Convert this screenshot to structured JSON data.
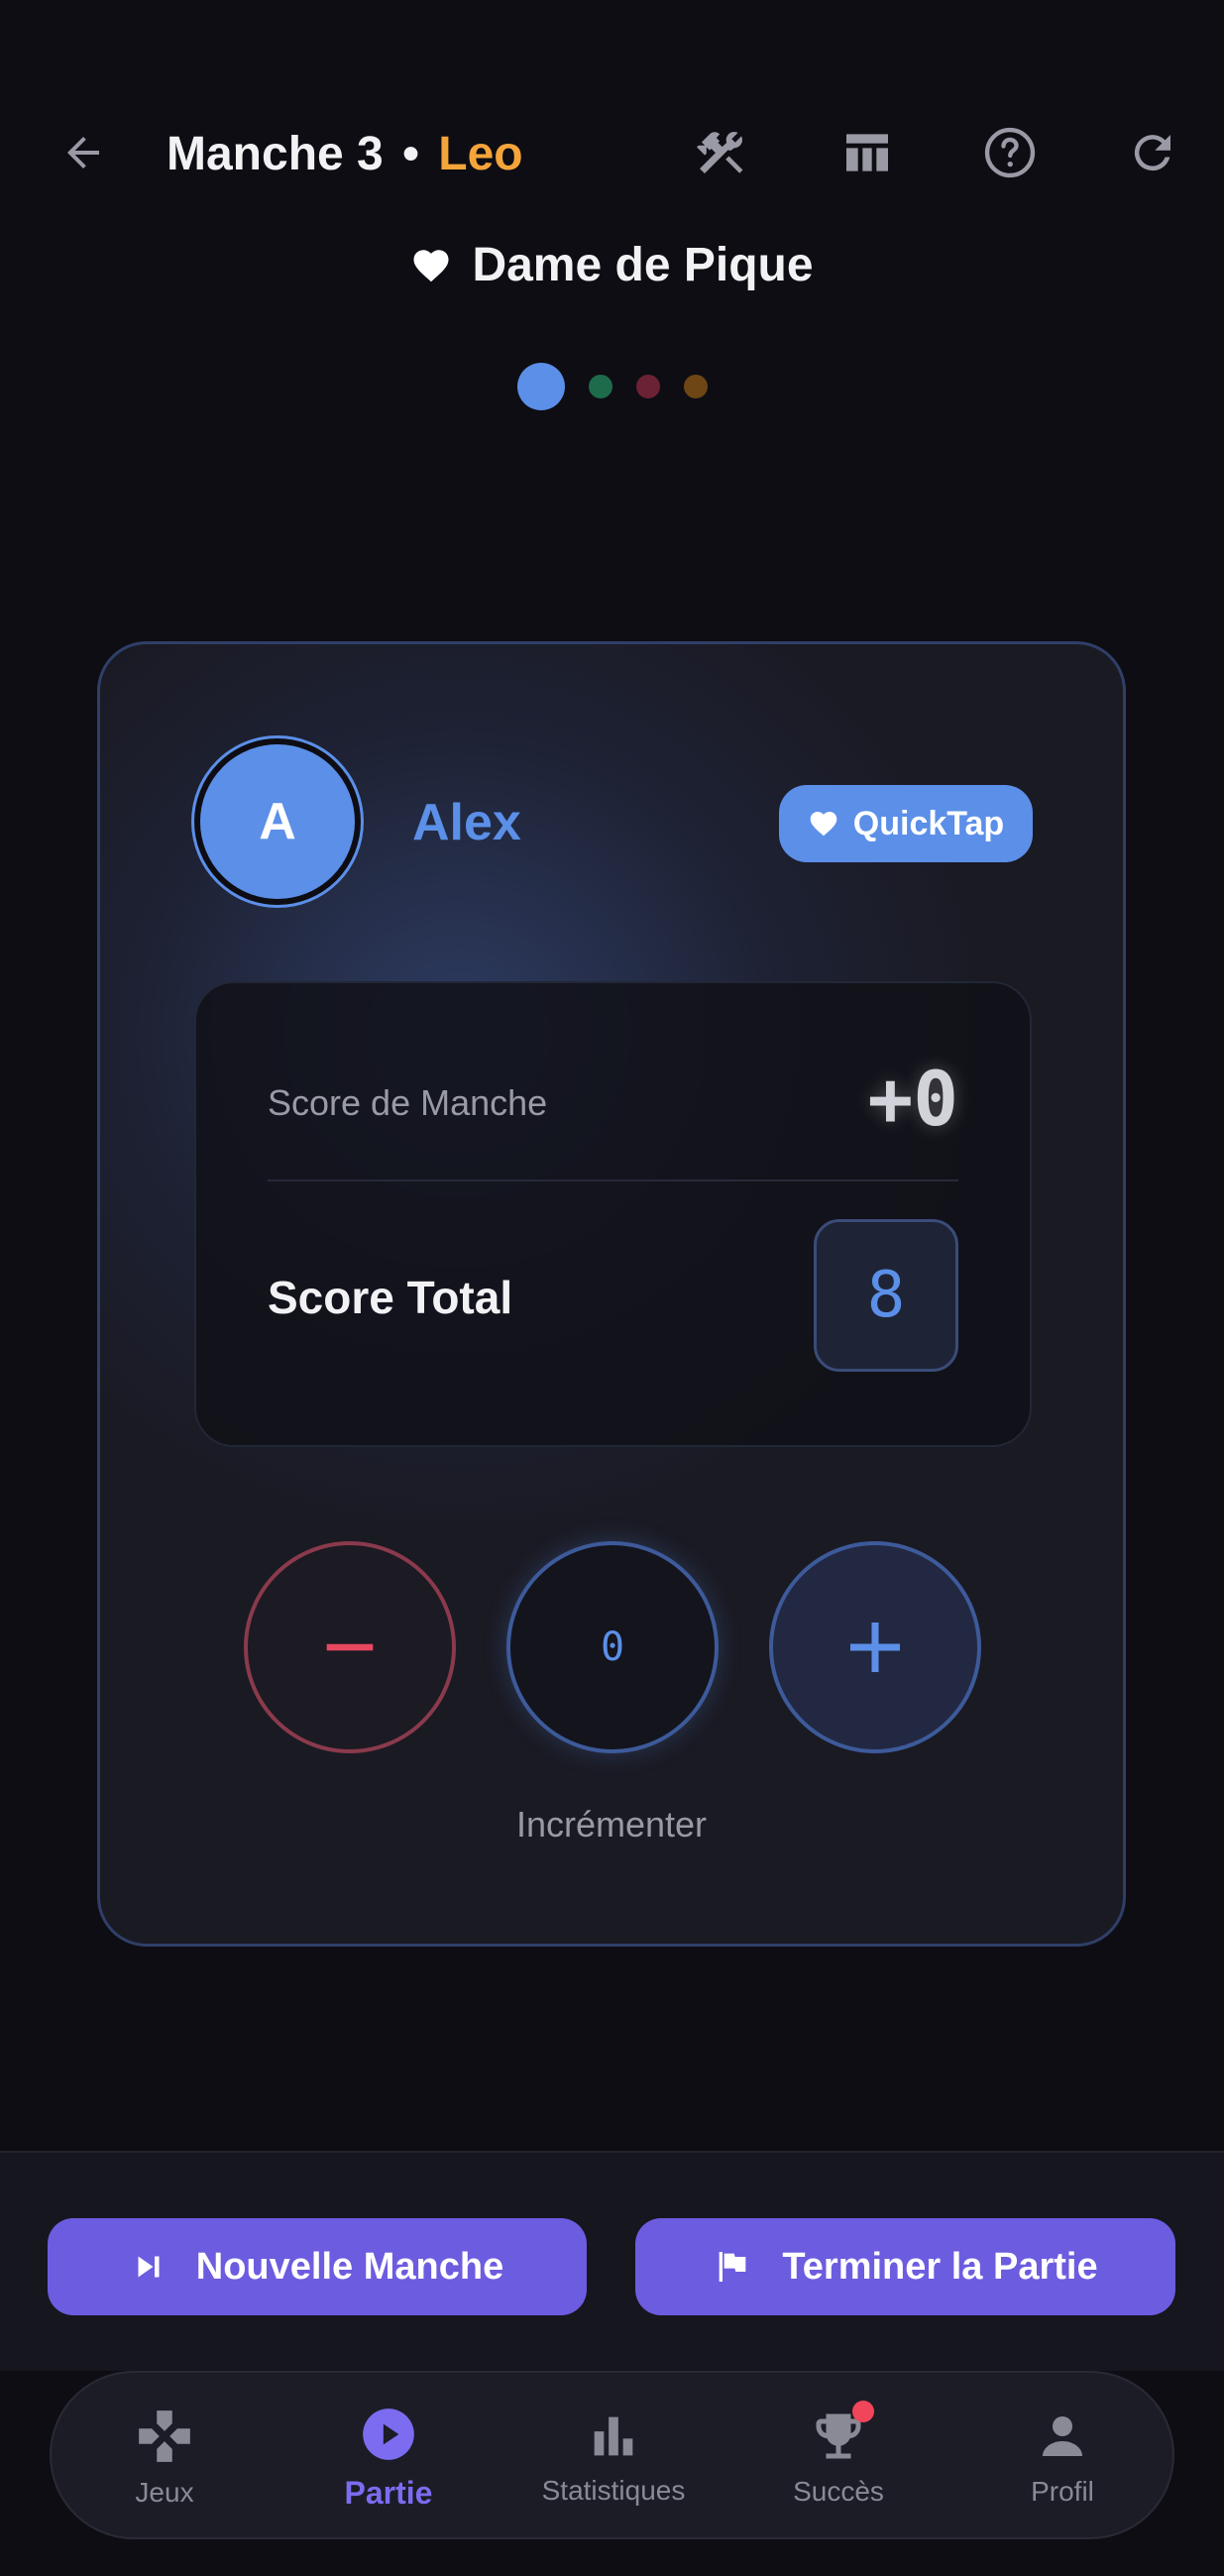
{
  "header": {
    "title": "Manche 3",
    "separator": "•",
    "current_player": "Leo",
    "game_name": "Dame de Pique",
    "icons": [
      "arrow-back-icon",
      "tools-icon",
      "table-icon",
      "help-icon",
      "refresh-icon"
    ]
  },
  "pagination": {
    "count": 4,
    "active_index": 0,
    "colors": [
      "#5b8fe8",
      "#1e6b4c",
      "#6b2234",
      "#6e4616"
    ]
  },
  "player_card": {
    "avatar_initial": "A",
    "name": "Alex",
    "quicktap_label": "QuickTap",
    "round_score_label": "Score de Manche",
    "round_score_value": "+0",
    "total_score_label": "Score Total",
    "total_score_value": "8",
    "stepper_value": "0",
    "stepper_caption": "Incrémenter",
    "accent_color": "#5b8fe8"
  },
  "actions": {
    "new_round_label": "Nouvelle Manche",
    "end_game_label": "Terminer la Partie",
    "button_color": "#6c5ce0"
  },
  "bottom_nav": {
    "items": [
      {
        "label": "Jeux",
        "icon": "gamepad-icon",
        "active": false
      },
      {
        "label": "Partie",
        "icon": "play-circle-icon",
        "active": true
      },
      {
        "label": "Statistiques",
        "icon": "bar-chart-icon",
        "active": false
      },
      {
        "label": "Succès",
        "icon": "trophy-icon",
        "active": false,
        "notification": true
      },
      {
        "label": "Profil",
        "icon": "person-icon",
        "active": false
      }
    ]
  }
}
